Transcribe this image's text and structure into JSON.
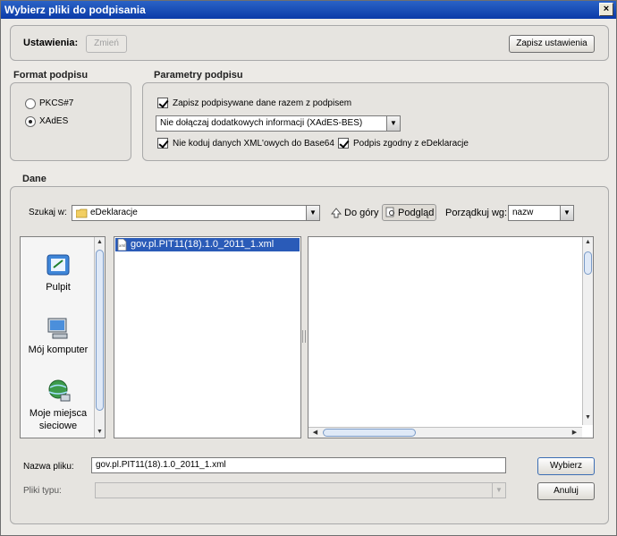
{
  "window": {
    "title": "Wybierz pliki do podpisania",
    "close_glyph": "×"
  },
  "settings": {
    "label": "Ustawienia:",
    "change_button": "Zmień",
    "save_button": "Zapisz ustawienia"
  },
  "format": {
    "title": "Format podpisu",
    "options": [
      {
        "label": "PKCS#7",
        "selected": false
      },
      {
        "label": "XAdES",
        "selected": true
      }
    ]
  },
  "params": {
    "title": "Parametry podpisu",
    "save_with_signature": "Zapisz podpisywane dane razem z podpisem",
    "info_select": "Nie dołączaj dodatkowych informacji (XAdES-BES)",
    "no_base64": "Nie koduj danych XML'owych do Base64",
    "edeklaracje_compat": "Podpis zgodny z eDeklaracje"
  },
  "data": {
    "title": "Dane",
    "look_in_label": "Szukaj w:",
    "look_in_value": "eDeklaracje",
    "up_button": "Do góry",
    "preview_button": "Podgląd",
    "sort_label": "Porządkuj wg:",
    "sort_value": "nazw",
    "places": [
      "Pulpit",
      "Mój komputer",
      "Moje miejsca sieciowe"
    ],
    "files": [
      "gov.pl.PIT11(18).1.0_2011_1.xml"
    ],
    "filename_label": "Nazwa pliku:",
    "filename_value": "gov.pl.PIT11(18).1.0_2011_1.xml",
    "filetype_label": "Pliki typu:",
    "filetype_value": "",
    "choose_button": "Wybierz",
    "cancel_button": "Anuluj"
  },
  "icons": {
    "desktop": "desktop-icon",
    "computer": "computer-icon",
    "network": "network-places-icon",
    "folder": "folder-icon",
    "up": "up-arrow-icon",
    "preview": "preview-icon",
    "xml_file": "xml-file-icon"
  },
  "colors": {
    "title_bar": "#0a3aa8",
    "selection": "#2a5bb8",
    "window_bg": "#eceae6"
  }
}
